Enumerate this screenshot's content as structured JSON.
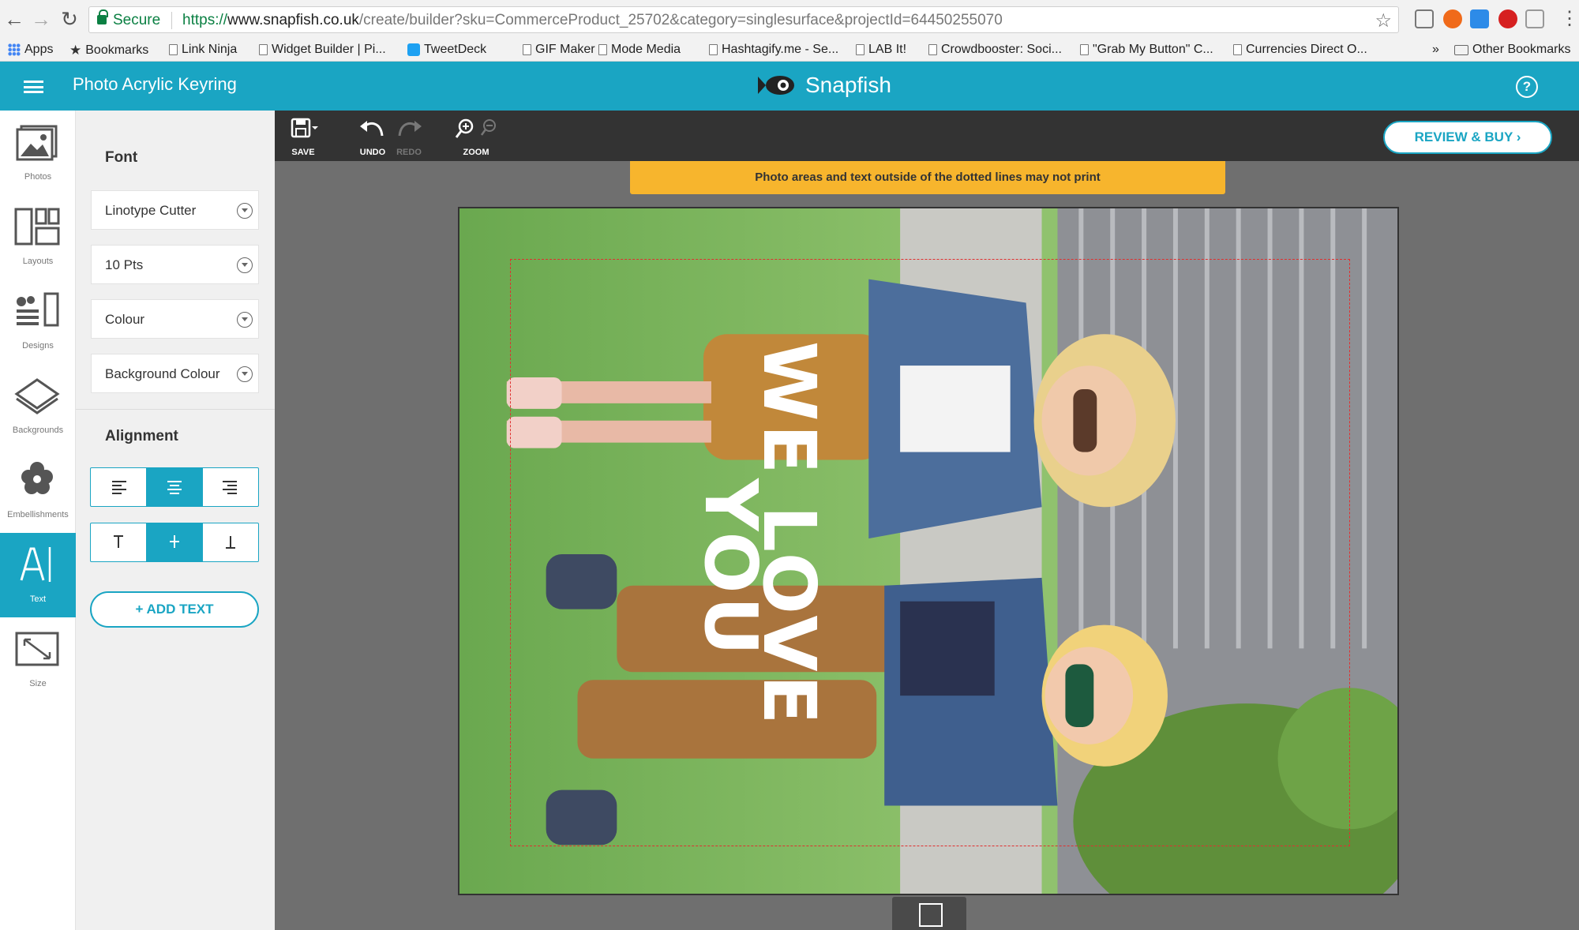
{
  "browser": {
    "secure_label": "Secure",
    "url_scheme": "https://",
    "url_domain": "www.snapfish.co.uk",
    "url_path": "/create/builder?sku=CommerceProduct_25702&category=singlesurface&projectId=64450255070",
    "bookmarks": [
      {
        "label": "Apps",
        "icon": "apps-grid-icon"
      },
      {
        "label": "Bookmarks",
        "icon": "star-icon"
      },
      {
        "label": "Link Ninja",
        "icon": "page-icon"
      },
      {
        "label": "Widget Builder | Pi...",
        "icon": "page-icon"
      },
      {
        "label": "TweetDeck",
        "icon": "tweetdeck-icon"
      },
      {
        "label": "GIF Maker",
        "icon": "page-icon"
      },
      {
        "label": "Mode Media",
        "icon": "page-icon"
      },
      {
        "label": "Hashtagify.me - Se...",
        "icon": "page-icon"
      },
      {
        "label": "LAB It!",
        "icon": "page-icon"
      },
      {
        "label": "Crowdbooster: Soci...",
        "icon": "page-icon"
      },
      {
        "label": "\"Grab My Button\" C...",
        "icon": "page-icon"
      },
      {
        "label": "Currencies Direct O...",
        "icon": "page-icon"
      }
    ],
    "overflow_label": "»",
    "other_bookmarks": "Other Bookmarks"
  },
  "header": {
    "product_title": "Photo Acrylic Keyring",
    "brand": "Snapfish",
    "help_symbol": "?"
  },
  "rail": [
    {
      "label": "Photos",
      "icon": "photos-icon",
      "active": false
    },
    {
      "label": "Layouts",
      "icon": "layouts-icon",
      "active": false
    },
    {
      "label": "Designs",
      "icon": "designs-icon",
      "active": false
    },
    {
      "label": "Backgrounds",
      "icon": "backgrounds-icon",
      "active": false
    },
    {
      "label": "Embellishments",
      "icon": "embellishments-icon",
      "active": false
    },
    {
      "label": "Text",
      "icon": "text-icon",
      "active": true
    },
    {
      "label": "Size",
      "icon": "size-icon",
      "active": false
    }
  ],
  "panel": {
    "font_heading": "Font",
    "font_family": "Linotype Cutter",
    "font_size": "10 Pts",
    "colour": "Colour",
    "background_colour": "Background Colour",
    "alignment_heading": "Alignment",
    "horizontal_align": "center",
    "vertical_align": "middle",
    "add_text": "ADD TEXT"
  },
  "toolbar": {
    "save": "SAVE",
    "undo": "UNDO",
    "redo": "REDO",
    "zoom": "ZOOM",
    "review": "REVIEW & BUY"
  },
  "canvas": {
    "warning": "Photo areas and text outside of the dotted lines may not print",
    "text_line1": "WE LOVE",
    "text_line2": "YOU"
  },
  "colors": {
    "accent": "#1aa5c3",
    "warning": "#f7b52d",
    "toolbar": "#333333"
  }
}
